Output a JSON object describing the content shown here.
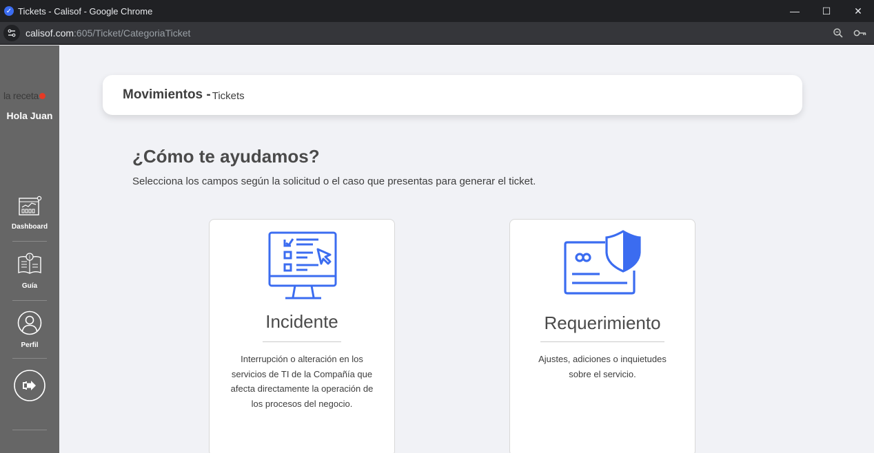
{
  "browser": {
    "window_title": "Tickets - Calisof - Google Chrome",
    "url_host": "calisof.com",
    "url_path": ":605/Ticket/CategoriaTicket"
  },
  "sidebar": {
    "logo_text": "la receta",
    "greeting": "Hola Juan",
    "items": [
      {
        "label": "Dashboard",
        "icon": "dashboard-icon"
      },
      {
        "label": "Guía",
        "icon": "guide-book-icon"
      },
      {
        "label": "Perfil",
        "icon": "profile-icon"
      },
      {
        "label": "",
        "icon": "logout-icon"
      }
    ]
  },
  "header": {
    "title": "Movimientos -",
    "subtitle": "Tickets"
  },
  "help": {
    "title": "¿Cómo te ayudamos?",
    "subtitle": "Selecciona los campos según la solicitud o el caso que presentas para generar el ticket."
  },
  "cards": [
    {
      "title": "Incidente",
      "description": "Interrupción o alteración en los servicios de TI de la Compañía que afecta directamente la operación de los procesos del negocio.",
      "icon": "monitor-checklist-icon"
    },
    {
      "title": "Requerimiento",
      "description": "Ajustes, adiciones o inquietudes sobre el servicio.",
      "icon": "card-shield-icon"
    }
  ],
  "colors": {
    "accent": "#3b6cf0",
    "sidebar_bg": "#666666",
    "page_bg": "#f1f2f6"
  }
}
